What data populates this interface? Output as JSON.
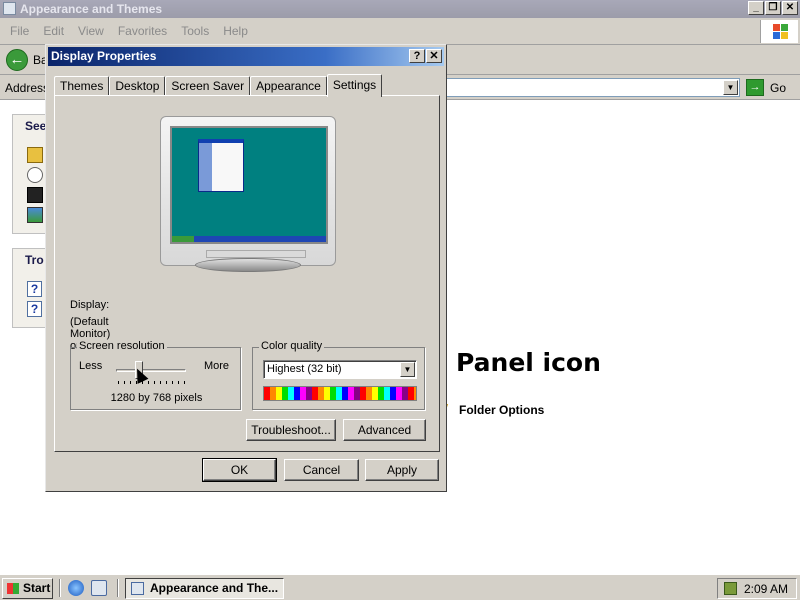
{
  "explorer": {
    "title": "Appearance and Themes",
    "menu": [
      "File",
      "Edit",
      "View",
      "Favorites",
      "Tools",
      "Help"
    ],
    "back_label": "Ba",
    "address_label": "Address",
    "go_label": "Go",
    "see_also_header": "See",
    "troubleshooters_header": "Tro",
    "heading_fragment": "Panel icon",
    "folder_options": "Folder Options"
  },
  "dialog": {
    "title": "Display Properties",
    "help_btn": "?",
    "close_btn": "✕",
    "tabs": [
      "Themes",
      "Desktop",
      "Screen Saver",
      "Appearance",
      "Settings"
    ],
    "active_tab": "Settings",
    "display_label": "Display:",
    "display_value": "(Default Monitor) on",
    "screen_resolution": {
      "title": "Screen resolution",
      "less": "Less",
      "more": "More",
      "value": "1280 by 768 pixels"
    },
    "color_quality": {
      "title": "Color quality",
      "selected": "Highest (32 bit)"
    },
    "troubleshoot_btn": "Troubleshoot...",
    "advanced_btn": "Advanced",
    "ok_btn": "OK",
    "cancel_btn": "Cancel",
    "apply_btn": "Apply"
  },
  "taskbar": {
    "start_label": "Start",
    "task_label": "Appearance and The...",
    "clock": "2:09 AM"
  }
}
